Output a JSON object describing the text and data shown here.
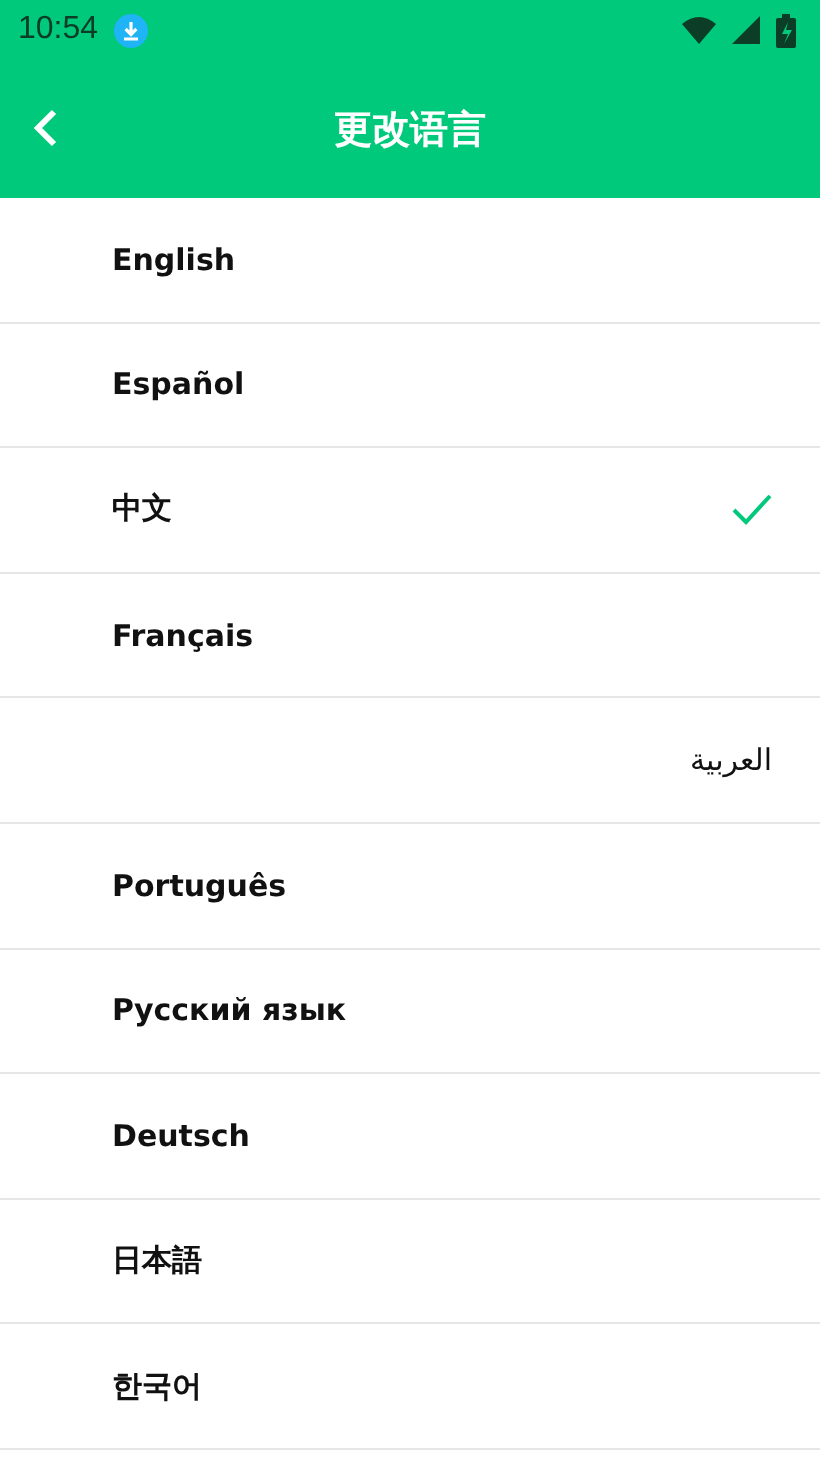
{
  "status_bar": {
    "time": "10:54"
  },
  "header": {
    "title": "更改语言"
  },
  "languages": [
    {
      "label": "English",
      "selected": false,
      "kind": "ltr"
    },
    {
      "label": "Español",
      "selected": false,
      "kind": "ltr"
    },
    {
      "label": "中文",
      "selected": true,
      "kind": "ltr"
    },
    {
      "label": "Français",
      "selected": false,
      "kind": "ltr"
    },
    {
      "label": "العربية",
      "selected": false,
      "kind": "rtl"
    },
    {
      "label": "Português",
      "selected": false,
      "kind": "ltr"
    },
    {
      "label": "Русский язык",
      "selected": false,
      "kind": "ltr"
    },
    {
      "label": "Deutsch",
      "selected": false,
      "kind": "ltr"
    },
    {
      "label": "日本語",
      "selected": false,
      "kind": "ltr"
    },
    {
      "label": "한국어",
      "selected": false,
      "kind": "ltr"
    }
  ]
}
